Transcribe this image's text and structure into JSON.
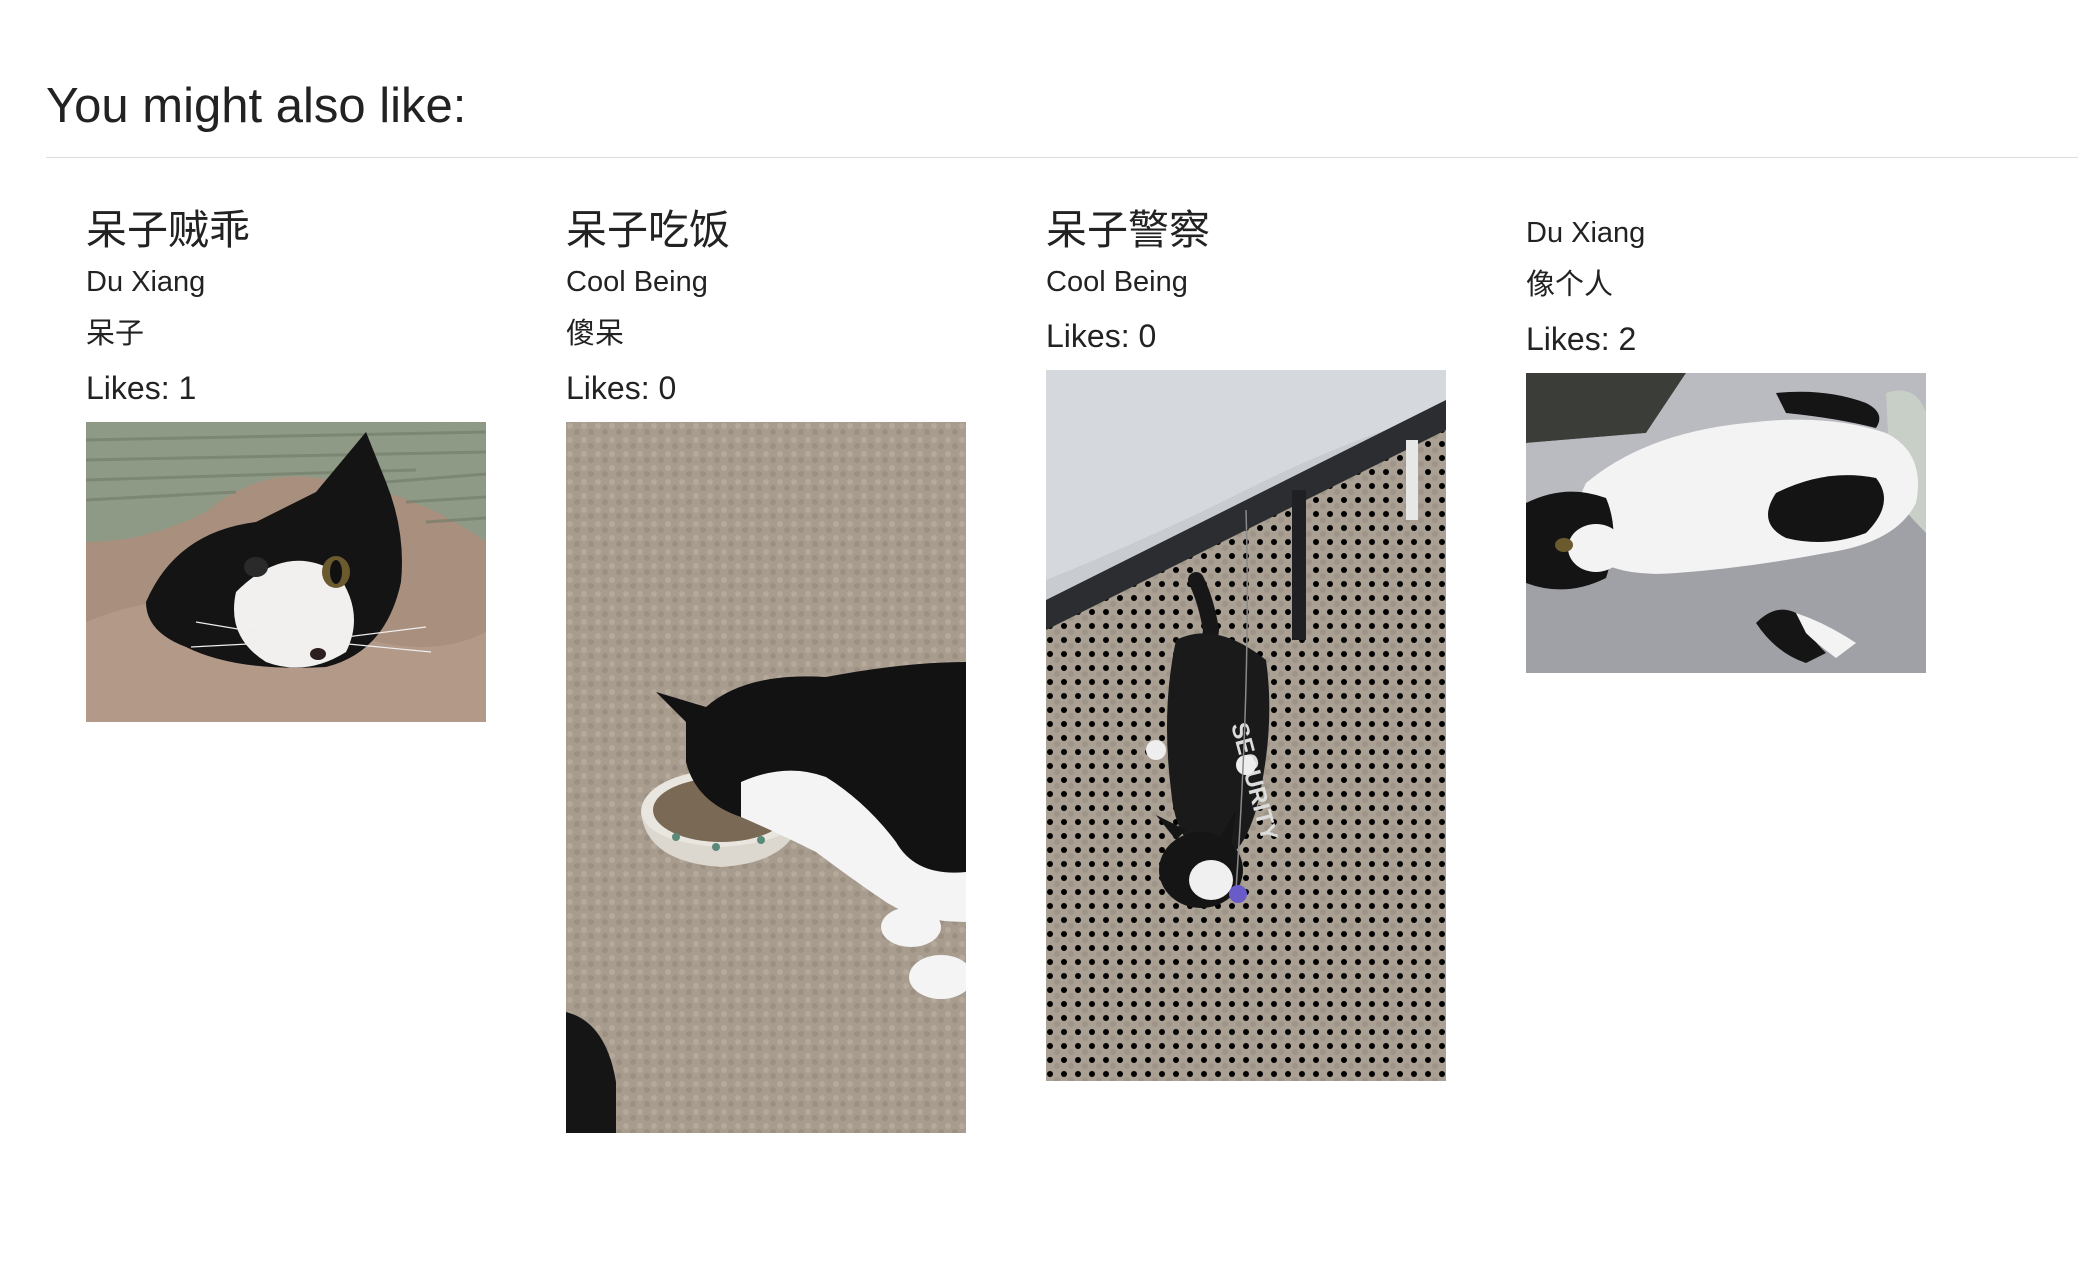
{
  "section": {
    "title": "You might also like:"
  },
  "cards": [
    {
      "title": "呆子贼乖",
      "author": "Du Xiang",
      "subject": "呆子",
      "likes_label": "Likes: 1",
      "photo": "cat-under-blanket-photo"
    },
    {
      "title": "呆子吃饭",
      "author": "Cool Being",
      "subject": "傻呆",
      "likes_label": "Likes: 0",
      "photo": "cat-eating-from-bowl-photo"
    },
    {
      "title": "呆子警察",
      "author": "Cool Being",
      "subject": "",
      "likes_label": "Likes: 0",
      "photo": "cat-in-security-shirt-photo",
      "shirt_text": "SECURITY"
    },
    {
      "title": "",
      "author": "Du Xiang",
      "subject": "像个人",
      "likes_label": "Likes: 2",
      "photo": "cat-lying-on-bed-photo"
    }
  ]
}
